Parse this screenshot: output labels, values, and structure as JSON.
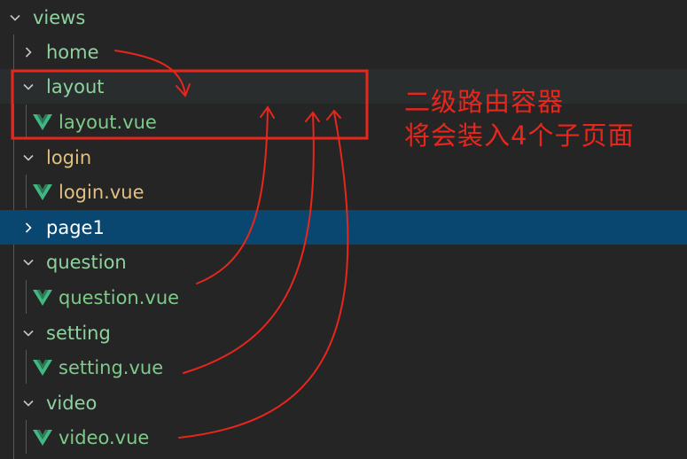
{
  "explorer": {
    "items": [
      {
        "label": "views",
        "kind": "folder",
        "expanded": true
      },
      {
        "label": "home",
        "kind": "folder",
        "expanded": false
      },
      {
        "label": "layout",
        "kind": "folder",
        "expanded": true
      },
      {
        "label": "layout.vue",
        "kind": "vue-file"
      },
      {
        "label": "login",
        "kind": "folder",
        "expanded": true
      },
      {
        "label": "login.vue",
        "kind": "vue-file"
      },
      {
        "label": "page1",
        "kind": "folder",
        "expanded": false,
        "selected": true
      },
      {
        "label": "question",
        "kind": "folder",
        "expanded": true
      },
      {
        "label": "question.vue",
        "kind": "vue-file"
      },
      {
        "label": "setting",
        "kind": "folder",
        "expanded": true
      },
      {
        "label": "setting.vue",
        "kind": "vue-file"
      },
      {
        "label": "video",
        "kind": "folder",
        "expanded": true
      },
      {
        "label": "video.vue",
        "kind": "vue-file"
      }
    ]
  },
  "annotation": {
    "line1": "二级路由容器",
    "line2": "将会装入4个子页面",
    "color": "#e8261c"
  },
  "colors": {
    "background": "#252526",
    "folder_text": "#8fd19e",
    "vue_file_text": "#7fc98a",
    "login_text": "#e0c080",
    "selected_background": "#094771",
    "vue_icon": "#41b883"
  }
}
